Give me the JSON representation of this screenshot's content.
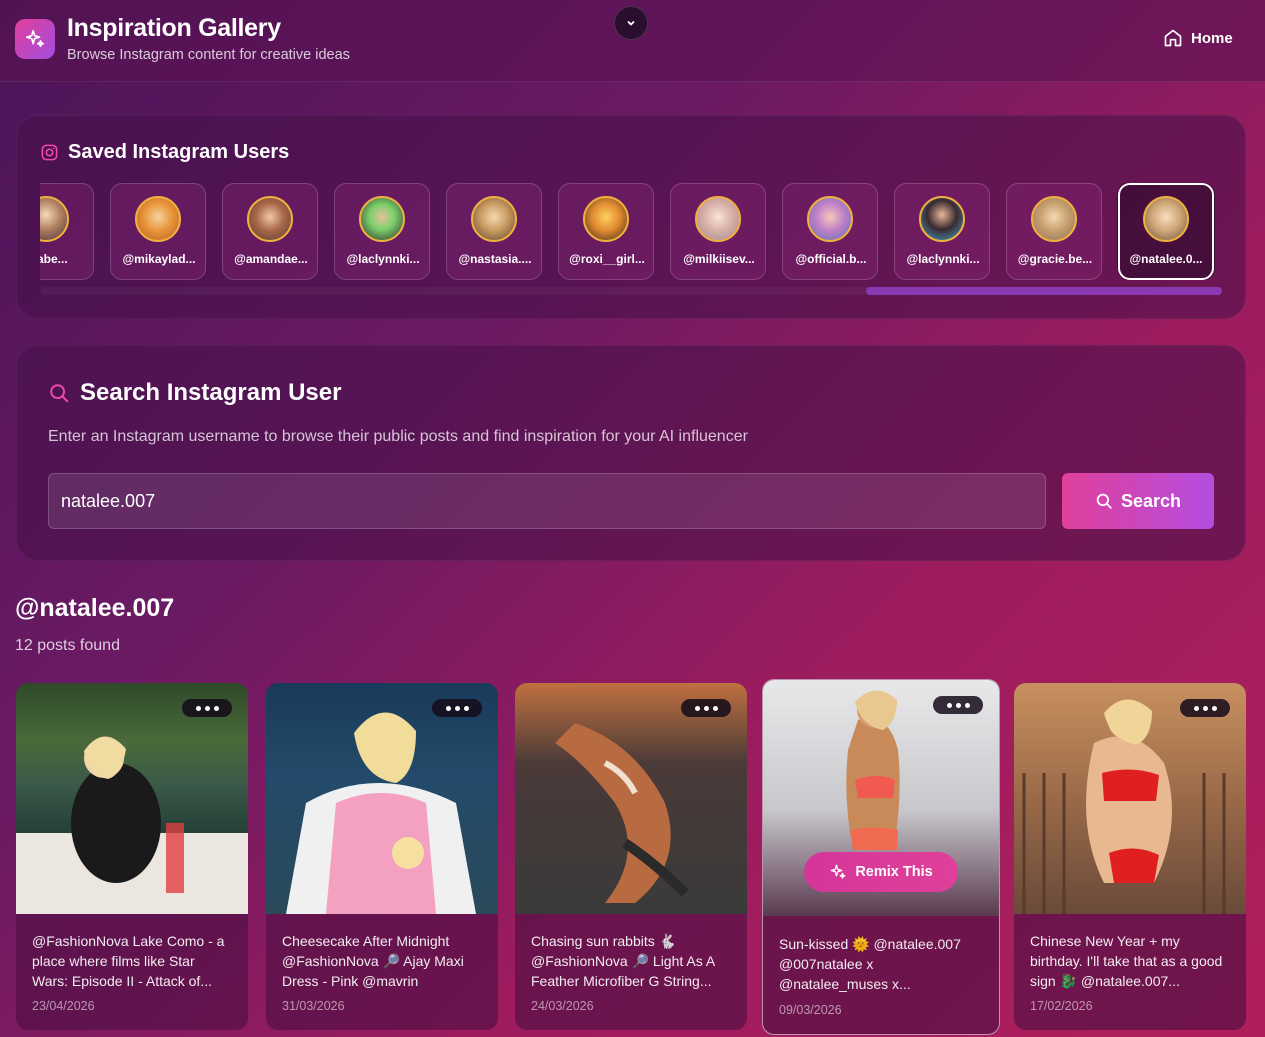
{
  "app": {
    "title": "Inspiration Gallery",
    "subtitle": "Browse Instagram content for creative ideas",
    "home_label": "Home"
  },
  "saved_users": {
    "title": "Saved Instagram Users",
    "items": [
      {
        "handle": "niabe..."
      },
      {
        "handle": "@mikaylad..."
      },
      {
        "handle": "@amandae..."
      },
      {
        "handle": "@laclynnki..."
      },
      {
        "handle": "@nastasia...."
      },
      {
        "handle": "@roxi__girl..."
      },
      {
        "handle": "@milkiisev..."
      },
      {
        "handle": "@official.b..."
      },
      {
        "handle": "@laclynnki..."
      },
      {
        "handle": "@gracie.be..."
      },
      {
        "handle": "@natalee.0..."
      }
    ],
    "selected_index": 10
  },
  "search": {
    "title": "Search Instagram User",
    "description": "Enter an Instagram username to browse their public posts and find inspiration for your AI influencer",
    "value": "natalee.007",
    "button_label": "Search"
  },
  "results": {
    "username": "@natalee.007",
    "count_text": "12 posts found",
    "posts": [
      {
        "caption": "@FashionNova Lake Como - a place where films like Star Wars: Episode II - Attack of...",
        "date": "23/04/2026"
      },
      {
        "caption": "Cheesecake After Midnight @FashionNova 🔎 Ajay Maxi Dress - Pink @mavrin",
        "date": "31/03/2026"
      },
      {
        "caption": "Chasing sun rabbits 🐇 @FashionNova 🔎 Light As A Feather Microfiber G String...",
        "date": "24/03/2026"
      },
      {
        "caption": "Sun-kissed 🌞 @natalee.007 @007natalee x @natalee_muses x...",
        "date": "09/03/2026",
        "remix_label": "Remix This"
      },
      {
        "caption": "Chinese New Year + my birthday. I'll take that as a good sign 🐉 @natalee.007...",
        "date": "17/02/2026"
      }
    ]
  },
  "colors": {
    "accent_pink": "#e0409a",
    "accent_purple": "#b44de0",
    "avatar_ring": "#f0b040"
  }
}
